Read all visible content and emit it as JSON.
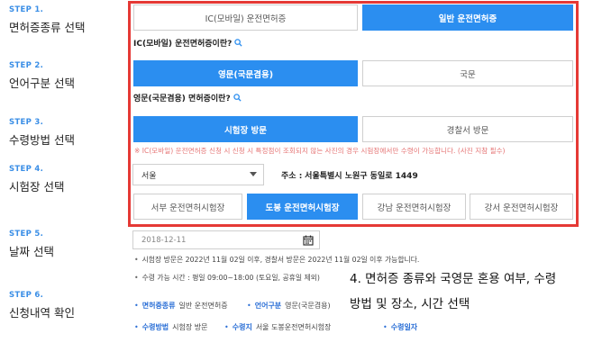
{
  "steps": [
    {
      "label": "STEP 1.",
      "title": "면허증종류 선택"
    },
    {
      "label": "STEP 2.",
      "title": "언어구분 선택"
    },
    {
      "label": "STEP 3.",
      "title": "수령방법 선택"
    },
    {
      "label": "STEP 4.",
      "title": "시험장 선택"
    },
    {
      "label": "STEP 5.",
      "title": "날짜 선택"
    },
    {
      "label": "STEP 6.",
      "title": "신청내역 확인"
    }
  ],
  "license_type": {
    "options": [
      "IC(모바일) 운전면허증",
      "일반 운전면허증"
    ],
    "selected_index": 1,
    "info_link": "IC(모바일) 운전면허증이란?"
  },
  "language": {
    "options": [
      "영문(국문겸용)",
      "국문"
    ],
    "selected_index": 0,
    "info_link": "영문(국문겸용) 면허증이란?"
  },
  "receive_method": {
    "options": [
      "시험장 방문",
      "경찰서 방문"
    ],
    "selected_index": 0,
    "notice": "※ IC(모바일) 운전면허증 신청 시 신청 시 특정점이 조회되지 않는 사진의 경우 시험장에서만 수령이 가능합니다. (사진 지참 필수)"
  },
  "test_center": {
    "region_select": "서울",
    "address_label": "주소 :",
    "address_value": "서울특별시 노원구 동일로 1449",
    "centers": [
      "서부 운전면허시험장",
      "도봉 운전면허시험장",
      "강남 운전면허시험장",
      "강서 운전면허시험장"
    ],
    "selected_index": 1
  },
  "date": {
    "value": "2018-12-11",
    "notes": [
      "시험장 방문은 2022년 11월 02일 이후, 경찰서 방문은 2022년 11월 02일 이후 가능합니다.",
      "수령 가능 시간 : 평일 09:00~18:00 (토요일, 공휴일 제외)"
    ]
  },
  "callout": {
    "line1": "4. 면허증 종류와 국영문 혼용 여부, 수령",
    "line2": "방법 및 장소, 시간 선택"
  },
  "summary": {
    "license_key": "면허증종류",
    "license_val": "일반 운전면허증",
    "language_key": "언어구분",
    "language_val": "영문(국문겸용)",
    "method_key": "수령방법",
    "method_val": "시험장 방문",
    "place_key": "수령지",
    "place_val": "서울 도봉운전면허시험장",
    "time_key": "수령일자",
    "time_val": ""
  },
  "colors": {
    "accent": "#2b8ef0",
    "highlight_frame": "#e53935",
    "notice": "#e57373",
    "step_label": "#3a8ee6"
  },
  "icons": {
    "info": "magnifier-icon",
    "calendar": "calendar-icon",
    "dropdown": "chevron-down-icon"
  }
}
